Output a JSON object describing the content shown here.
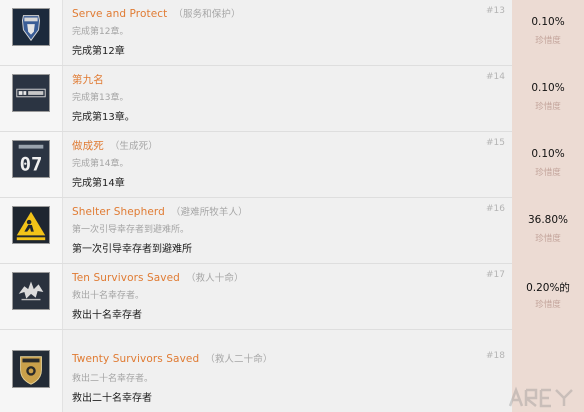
{
  "colors": {
    "title": "#e07b33",
    "subtitle": "#a6a6a6",
    "rarity_bg": "#ecdbd3",
    "row_bg": "#f0f0f0"
  },
  "achievements": [
    {
      "icon": "police-badge-icon",
      "title": "Serve and Protect",
      "subtitle": "（服务和保护）",
      "rank": "#13",
      "desc_gray": "完成第12章。",
      "desc": "完成第12章",
      "rarity": "0.10%",
      "rarity_label": "珍惜度"
    },
    {
      "icon": "ninth-place-logo-icon",
      "title": "第九名",
      "subtitle": "",
      "rank": "#14",
      "desc_gray": "完成第13章。",
      "desc": "完成第13章。",
      "rarity": "0.10%",
      "rarity_label": "珍惜度"
    },
    {
      "icon": "number-07-sign-icon",
      "title": "做成死",
      "subtitle": "（生成死）",
      "rank": "#15",
      "desc_gray": "完成第14章。",
      "desc": "完成第14章",
      "rarity": "0.10%",
      "rarity_label": "珍惜度"
    },
    {
      "icon": "shelter-warning-sign-icon",
      "title": "Shelter Shepherd",
      "subtitle": "（避难所牧羊人）",
      "rank": "#16",
      "desc_gray": "第一次引导幸存者到避难所。",
      "desc": "第一次引导幸存者到避难所",
      "rarity": "36.80%",
      "rarity_label": "珍惜度"
    },
    {
      "icon": "dragon-crest-icon",
      "title": "Ten Survivors Saved",
      "subtitle": "（救人十命）",
      "rank": "#17",
      "desc_gray": "救出十名幸存者。",
      "desc": "救出十名幸存者",
      "rarity": "0.20%的",
      "rarity_label": "珍惜度"
    },
    {
      "icon": "survivor-shield-badge-icon",
      "title": "Twenty Survivors Saved",
      "subtitle": "（救人二十命）",
      "rank": "#18",
      "desc_gray": "救出二十名幸存者。",
      "desc": "救出二十名幸存者",
      "rarity": "",
      "rarity_label": ""
    }
  ]
}
